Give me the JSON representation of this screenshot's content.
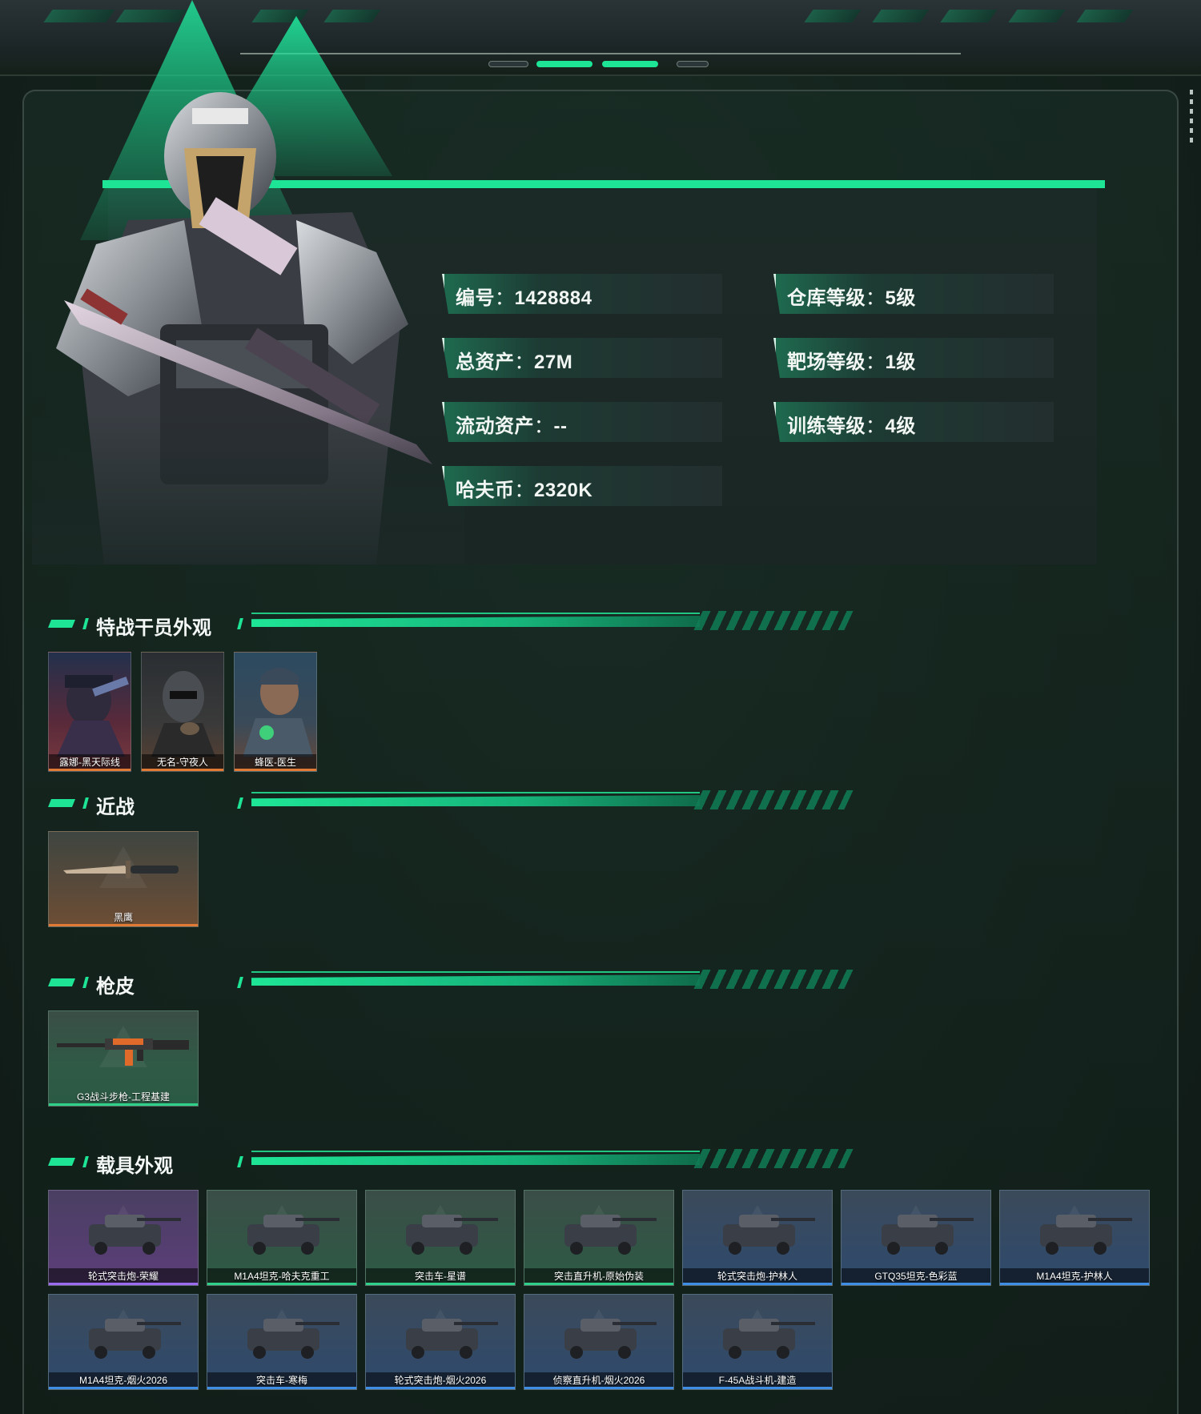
{
  "profile": {
    "fields": [
      {
        "label": "编号",
        "value": "1428884"
      },
      {
        "label": "仓库等级",
        "value": "5级"
      },
      {
        "label": "总资产",
        "value": "27M"
      },
      {
        "label": "靶场等级",
        "value": "1级"
      },
      {
        "label": "流动资产",
        "value": "--"
      },
      {
        "label": "训练等级",
        "value": "4级"
      },
      {
        "label": "哈夫币",
        "value": "2320K"
      }
    ]
  },
  "sections": {
    "agents": {
      "title": "特战干员外观",
      "items": [
        "露娜-黑天际线",
        "无名-守夜人",
        "蜂医-医生"
      ]
    },
    "melee": {
      "title": "近战",
      "items": [
        "黑鹰"
      ]
    },
    "skins": {
      "title": "枪皮",
      "items": [
        "G3战斗步枪-工程基建"
      ]
    },
    "vehicles": {
      "title": "载具外观",
      "items": [
        {
          "name": "轮式突击炮-荣耀",
          "rarity": "purple"
        },
        {
          "name": "M1A4坦克-哈夫克重工",
          "rarity": "green"
        },
        {
          "name": "突击车-星谱",
          "rarity": "green"
        },
        {
          "name": "突击直升机-原始伪装",
          "rarity": "green"
        },
        {
          "name": "轮式突击炮-护林人",
          "rarity": "blue"
        },
        {
          "name": "GTQ35坦克-色彩蓝",
          "rarity": "blue"
        },
        {
          "name": "M1A4坦克-护林人",
          "rarity": "blue"
        },
        {
          "name": "M1A4坦克-烟火2026",
          "rarity": "blue"
        },
        {
          "name": "突击车-寒梅",
          "rarity": "blue"
        },
        {
          "name": "轮式突击炮-烟火2026",
          "rarity": "blue"
        },
        {
          "name": "侦察直升机-烟火2026",
          "rarity": "blue"
        },
        {
          "name": "F-45A战斗机-建造",
          "rarity": "blue"
        }
      ]
    }
  },
  "colors": {
    "accent": "#1ee596",
    "rarity_purple": "#9b6cf0",
    "rarity_green": "#2fd08a",
    "rarity_blue": "#3f8ee6",
    "rarity_orange": "#e07a35"
  }
}
